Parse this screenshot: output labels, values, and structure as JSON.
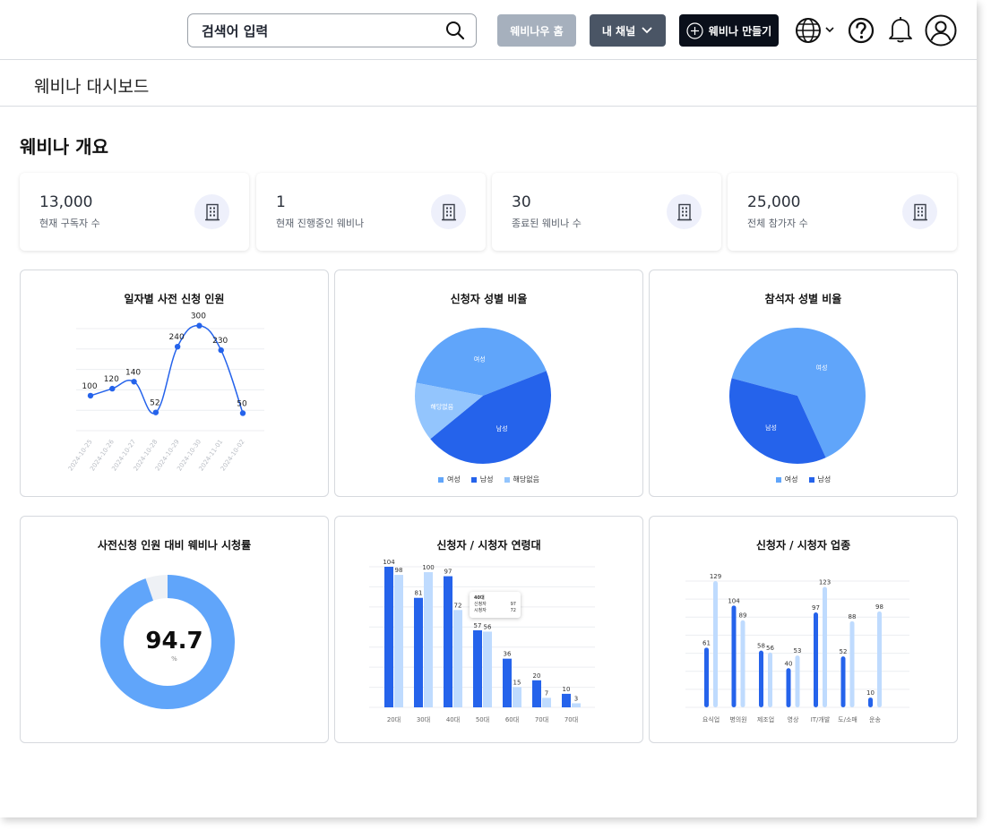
{
  "header": {
    "search_placeholder": "검색어 입력",
    "home_button": "웨비나우 홈",
    "channel_button": "내 채널",
    "create_button": "웨비나 만들기"
  },
  "page": {
    "dashboard_title": "웨비나 대시보드",
    "section_title": "웨비나 개요"
  },
  "stats": [
    {
      "value": "13,000",
      "label": "현재 구독자 수"
    },
    {
      "value": "1",
      "label": "현재 진행중인 웨비나"
    },
    {
      "value": "30",
      "label": "종료된 웨비나 수"
    },
    {
      "value": "25,000",
      "label": "전체 참가자 수"
    }
  ],
  "colors": {
    "dark_blue": "#2563eb",
    "mid_blue": "#60a5fa",
    "light_blue": "#bfdbfe",
    "pale_blue": "#93c5fd"
  },
  "chart_data": [
    {
      "type": "line",
      "title": "일자별 사전 신청 인원",
      "x": [
        "2024-10-25",
        "2024-10-26",
        "2024-10-27",
        "2024-10-28",
        "2024-10-29",
        "2024-10-30",
        "2024-11-01",
        "2024-10-02"
      ],
      "values": [
        100,
        120,
        140,
        52,
        240,
        300,
        230,
        50
      ],
      "ylim": [
        0,
        330
      ]
    },
    {
      "type": "pie",
      "title": "신청자 성별 비율",
      "labels": [
        "여성",
        "남성",
        "해당없음"
      ],
      "values": [
        41,
        45,
        14
      ],
      "legend": [
        "여성",
        "남성",
        "해당없음"
      ]
    },
    {
      "type": "pie",
      "title": "참석자 성별 비율",
      "labels": [
        "여성",
        "남성"
      ],
      "values": [
        64,
        36
      ],
      "legend": [
        "여성",
        "남성"
      ]
    },
    {
      "type": "donut",
      "title": "사전신청 인원 대비 웨비나 시청률",
      "value": 94.7,
      "display": "94.7",
      "unit": "%"
    },
    {
      "type": "bar",
      "title": "신청자 / 시청자 연령대",
      "categories": [
        "20대",
        "30대",
        "40대",
        "50대",
        "60대",
        "70대",
        "70대"
      ],
      "series": [
        {
          "values": [
            104,
            81,
            97,
            57,
            36,
            20,
            10
          ]
        },
        {
          "values": [
            98,
            100,
            72,
            56,
            15,
            7,
            3
          ]
        }
      ],
      "ylim": [
        0,
        104
      ],
      "tooltip": {
        "title": "40대",
        "row1_label": "신청자",
        "row1_value": "97",
        "row2_label": "시청자",
        "row2_value": "72"
      }
    },
    {
      "type": "bar",
      "title": "신청자 / 시청자 업종",
      "categories": [
        "요식업",
        "병의원",
        "제조업",
        "영상",
        "IT/개발",
        "도/소매",
        "운송"
      ],
      "series": [
        {
          "values": [
            61,
            104,
            58,
            40,
            97,
            52,
            10
          ]
        },
        {
          "values": [
            129,
            89,
            56,
            53,
            123,
            88,
            98
          ]
        }
      ],
      "ylim": [
        0,
        129
      ]
    }
  ]
}
